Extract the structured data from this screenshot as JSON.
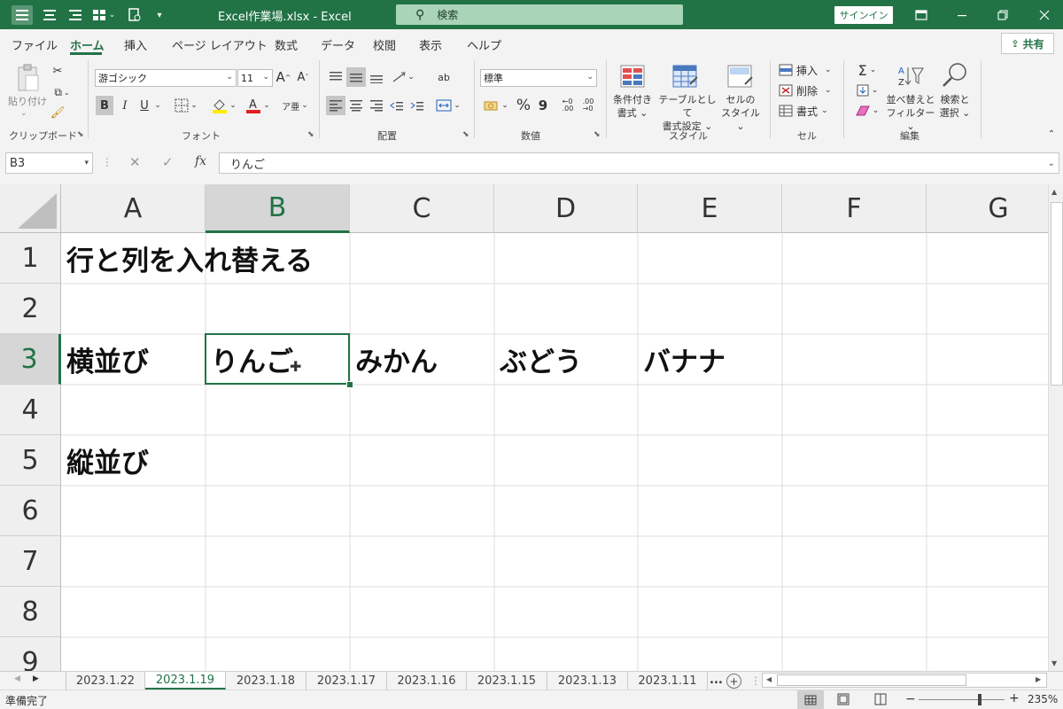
{
  "titlebar": {
    "title": "Excel作業場.xlsx  -  Excel",
    "search_placeholder": "検索",
    "signin": "サインイン",
    "accent": "#217346"
  },
  "tabs": [
    "ファイル",
    "ホーム",
    "挿入",
    "ページ レイアウト",
    "数式",
    "データ",
    "校閲",
    "表示",
    "ヘルプ"
  ],
  "active_tab": "ホーム",
  "share_label": "共有",
  "ribbon": {
    "clipboard": {
      "paste": "貼り付け",
      "label": "クリップボード"
    },
    "font": {
      "name": "游ゴシック",
      "size": "11",
      "bold": "B",
      "italic": "I",
      "underline": "U",
      "label": "フォント"
    },
    "alignment": {
      "label": "配置"
    },
    "number": {
      "format": "標準",
      "percent": "%",
      "comma": "9",
      "label": "数値"
    },
    "styles": {
      "conditional": [
        "条件付き",
        "書式"
      ],
      "table": [
        "テーブルとして",
        "書式設定"
      ],
      "cell": [
        "セルの",
        "スタイル"
      ],
      "label": "スタイル"
    },
    "cells": {
      "insert": "挿入",
      "delete": "削除",
      "format": "書式",
      "label": "セル"
    },
    "editing": {
      "sort": [
        "並べ替えと",
        "フィルター"
      ],
      "find": [
        "検索と",
        "選択"
      ],
      "sigma": "Σ",
      "label": "編集"
    }
  },
  "formula_bar": {
    "name_box": "B3",
    "fx": "fx",
    "value": "りんご"
  },
  "columns": [
    "A",
    "B",
    "C",
    "D",
    "E",
    "F",
    "G"
  ],
  "selected_column": "B",
  "rows": [
    "1",
    "2",
    "3",
    "4",
    "5",
    "6",
    "7",
    "8",
    "9"
  ],
  "selected_row": "3",
  "cells": {
    "A1": "行と列を入れ替える",
    "A3": "横並び",
    "B3": "りんご",
    "C3": "みかん",
    "D3": "ぶどう",
    "E3": "バナナ",
    "A5": "縦並び"
  },
  "sheet_tabs": [
    "2023.1.22",
    "2023.1.19",
    "2023.1.18",
    "2023.1.17",
    "2023.1.16",
    "2023.1.15",
    "2023.1.13",
    "2023.1.11"
  ],
  "active_sheet": "2023.1.19",
  "sheet_more": "...",
  "status": {
    "ready": "準備完了",
    "zoom": "235%",
    "minus": "−",
    "plus": "+"
  }
}
